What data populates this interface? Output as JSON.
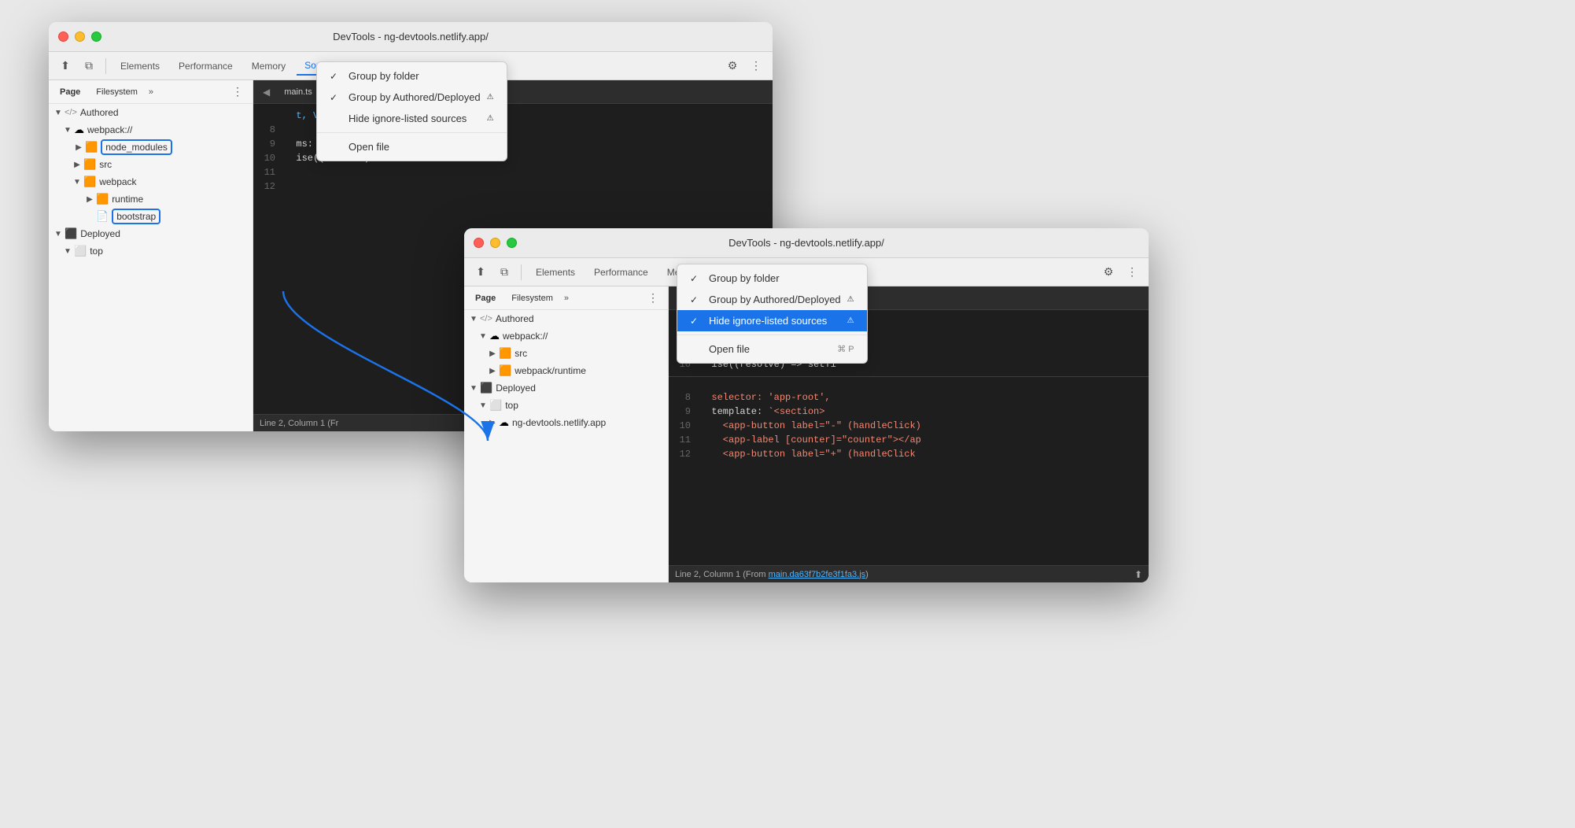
{
  "window1": {
    "title": "DevTools - ng-devtools.netlify.app/",
    "toolbar": {
      "tabs": [
        "Elements",
        "Performance",
        "Memory",
        "Sources"
      ],
      "activeTab": "Sources"
    },
    "subToolbar": {
      "tabs": [
        "Page",
        "Filesystem"
      ],
      "activeTab": "Page"
    },
    "editorTabs": [
      "main.ts",
      "app.component.ts"
    ],
    "activeEditorTab": "app.component.ts",
    "fileTree": {
      "items": [
        {
          "label": "Authored",
          "level": 0,
          "type": "tag",
          "expanded": true
        },
        {
          "label": "webpack://",
          "level": 1,
          "type": "cloud",
          "expanded": true
        },
        {
          "label": "node_modules",
          "level": 2,
          "type": "folder",
          "expanded": false,
          "outlined": true
        },
        {
          "label": "src",
          "level": 2,
          "type": "folder",
          "expanded": false
        },
        {
          "label": "webpack",
          "level": 2,
          "type": "folder",
          "expanded": true
        },
        {
          "label": "runtime",
          "level": 3,
          "type": "folder",
          "expanded": false
        },
        {
          "label": "bootstrap",
          "level": 3,
          "type": "file",
          "outlined": true
        },
        {
          "label": "Deployed",
          "level": 0,
          "type": "cube",
          "expanded": true
        },
        {
          "label": "top",
          "level": 1,
          "type": "square",
          "expanded": false
        }
      ]
    },
    "codeLines": [
      {
        "num": "",
        "code": "  t, ViewEncapsulation",
        "classes": [
          "c-blue"
        ]
      },
      {
        "num": "8",
        "code": ""
      },
      {
        "num": "9",
        "code": "  ms: number) {",
        "classes": [
          "c-white"
        ]
      },
      {
        "num": "10",
        "code": "  ise((resolve) => setTi",
        "classes": [
          "c-white"
        ]
      },
      {
        "num": "11",
        "code": ""
      },
      {
        "num": "12",
        "code": ""
      }
    ],
    "statusBar": "Line 2, Column 1 (Fr",
    "contextMenu": {
      "visible": true,
      "items": [
        {
          "label": "Group by folder",
          "checked": true,
          "shortcut": ""
        },
        {
          "label": "Group by Authored/Deployed",
          "checked": true,
          "warn": true,
          "shortcut": ""
        },
        {
          "label": "Hide ignore-listed sources",
          "warn": true,
          "shortcut": ""
        },
        {
          "label": "Open file",
          "shortcut": ""
        }
      ]
    }
  },
  "window2": {
    "title": "DevTools - ng-devtools.netlify.app/",
    "toolbar": {
      "tabs": [
        "Elements",
        "Performance",
        "Memory",
        "Sources"
      ],
      "activeTab": "Sources"
    },
    "subToolbar": {
      "tabs": [
        "Page",
        "Filesystem"
      ],
      "activeTab": "Page"
    },
    "editorTabs": [
      "main.ts",
      "app.component.ts"
    ],
    "activeEditorTab": "app.component.ts",
    "fileTree": {
      "items": [
        {
          "label": "Authored",
          "level": 0,
          "type": "tag",
          "expanded": true
        },
        {
          "label": "webpack://",
          "level": 1,
          "type": "cloud",
          "expanded": true
        },
        {
          "label": "src",
          "level": 2,
          "type": "folder",
          "expanded": false
        },
        {
          "label": "webpack/runtime",
          "level": 2,
          "type": "folder",
          "expanded": false
        },
        {
          "label": "Deployed",
          "level": 0,
          "type": "cube",
          "expanded": true
        },
        {
          "label": "top",
          "level": 1,
          "type": "square",
          "expanded": true
        },
        {
          "label": "ng-devtools.netlify.app",
          "level": 2,
          "type": "cloud",
          "expanded": false
        }
      ]
    },
    "codeLines": [
      {
        "num": "",
        "code": "  t, ViewEncapsulation",
        "classes": [
          "c-blue"
        ]
      },
      {
        "num": "8",
        "code": ""
      },
      {
        "num": "9",
        "code": "  ms: number) {",
        "classes": [
          "c-white"
        ]
      },
      {
        "num": "10",
        "code": "  ise((resolve) => setTi",
        "classes": [
          "c-white"
        ]
      },
      {
        "num": "11",
        "code": ""
      },
      {
        "num": "12",
        "code": ""
      }
    ],
    "codeLines2": [
      {
        "num": "8",
        "code": "  selector: 'app-root',",
        "color": "c-red"
      },
      {
        "num": "9",
        "code": "  template: `<section>",
        "color": "c-white"
      },
      {
        "num": "10",
        "code": "    <app-button label=\"-\" (handleClick)",
        "color": "c-red"
      },
      {
        "num": "11",
        "code": "    <app-label [counter]=\"counter\"></ap",
        "color": "c-red"
      },
      {
        "num": "12",
        "code": "    <app-button label=\"+\" (handleClick",
        "color": "c-red"
      }
    ],
    "statusBar": "Line 2, Column 1 (From main.da63f7b2fe3f1fa3.js)",
    "contextMenu": {
      "visible": true,
      "items": [
        {
          "label": "Group by folder",
          "checked": true,
          "shortcut": ""
        },
        {
          "label": "Group by Authored/Deployed",
          "checked": true,
          "warn": true,
          "shortcut": ""
        },
        {
          "label": "Hide ignore-listed sources",
          "checked": true,
          "warn": true,
          "shortcut": "",
          "highlighted": true
        },
        {
          "label": "Open file",
          "shortcut": "⌘ P"
        }
      ]
    }
  },
  "icons": {
    "cursor": "⬆",
    "layers": "⧉",
    "gear": "⚙",
    "more": "⋮",
    "more_h": "»",
    "page": "📄",
    "back": "◀",
    "close": "✕",
    "check": "✓",
    "folder_open": "▼",
    "folder_closed": "▶",
    "arrow_right": "▶"
  }
}
